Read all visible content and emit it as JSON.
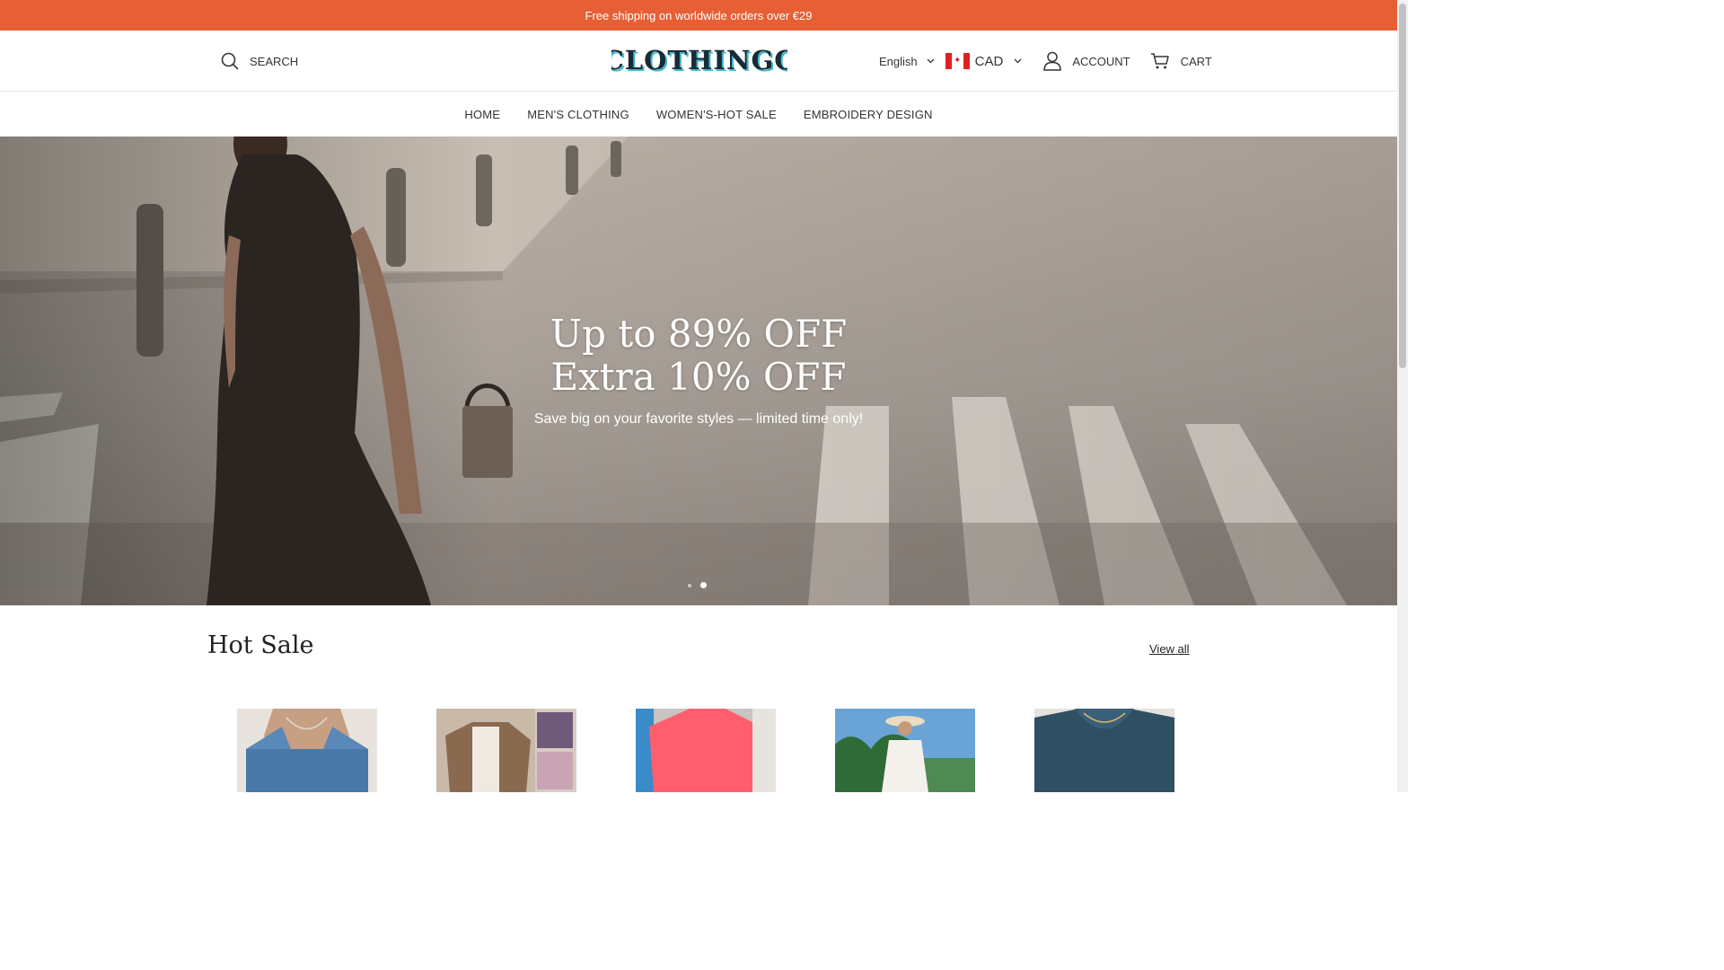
{
  "announcement": "Free shipping on worldwide orders over €29",
  "header": {
    "search_label": "SEARCH",
    "logo": "CLOTHINGC",
    "language": "English",
    "currency": "CAD",
    "account_label": "ACCOUNT",
    "cart_label": "CART"
  },
  "nav": [
    "HOME",
    "MEN'S CLOTHING",
    "WOMEN'S-HOT SALE",
    "EMBROIDERY DESIGN"
  ],
  "hero": {
    "title_line1": "Up to 89% OFF",
    "title_line2": "Extra 10% OFF",
    "subtitle": "Save big on your favorite styles — limited time only!",
    "slides": 2,
    "active_slide": 2
  },
  "hot_sale": {
    "title": "Hot Sale",
    "view_all": "View all"
  },
  "colors": {
    "announcement_bg": "#e65f35",
    "logo_text": "#1a2a35",
    "logo_shadow": "#3fb9c9"
  }
}
